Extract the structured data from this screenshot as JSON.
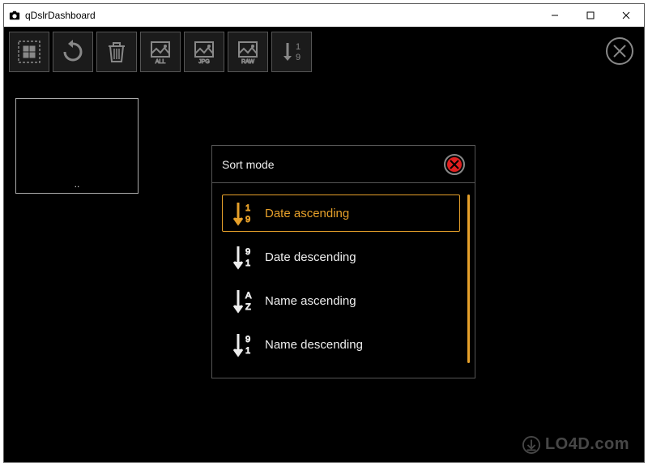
{
  "window": {
    "title": "qDslrDashboard"
  },
  "toolbar": {
    "select_all": "select-all",
    "rotate": "rotate",
    "delete": "delete",
    "filter_all": "ALL",
    "filter_jpg": "JPG",
    "filter_raw": "RAW",
    "sort": "sort"
  },
  "thumb": {
    "caption": ".."
  },
  "modal": {
    "title": "Sort mode",
    "options": [
      {
        "label": "Date ascending",
        "top": "1",
        "bot": "9",
        "selected": true
      },
      {
        "label": "Date descending",
        "top": "9",
        "bot": "1",
        "selected": false
      },
      {
        "label": "Name ascending",
        "top": "A",
        "bot": "Z",
        "selected": false
      },
      {
        "label": "Name descending",
        "top": "9",
        "bot": "1",
        "selected": false
      }
    ]
  },
  "watermark": {
    "text": "LO4D.com"
  }
}
